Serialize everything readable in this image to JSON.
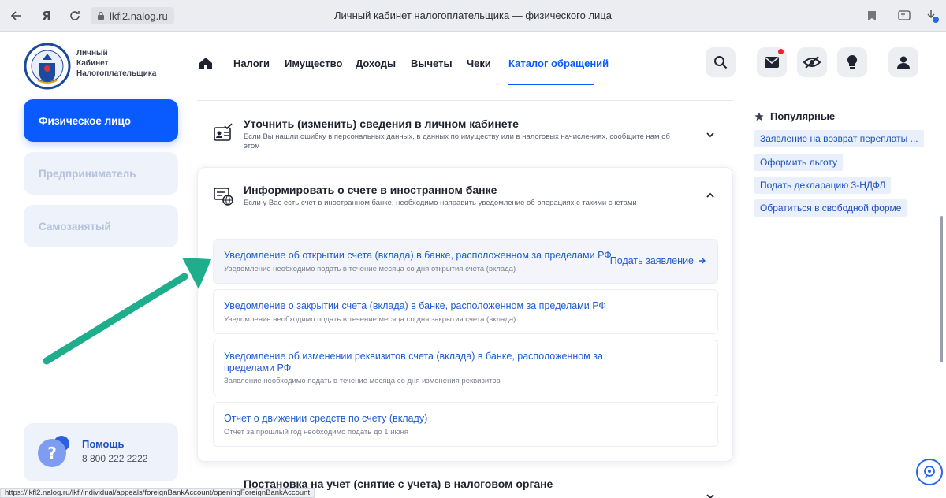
{
  "browser": {
    "url": "lkfl2.nalog.ru",
    "title": "Личный кабинет налогоплательщика — физического лица",
    "status_url": "https://lkfl2.nalog.ru/lkfl/individual/appeals/foreignBankAccount/openingForeignBankAccount"
  },
  "sidebar": {
    "logo_text": [
      "Личный",
      "Кабинет",
      "Налогоплательщика"
    ],
    "items": [
      {
        "label": "Физическое лицо",
        "active": true
      },
      {
        "label": "Предприниматель",
        "active": false
      },
      {
        "label": "Самозанятый",
        "active": false
      }
    ],
    "help": {
      "title": "Помощь",
      "phone": "8 800 222 2222"
    }
  },
  "nav": {
    "items": [
      "Налоги",
      "Имущество",
      "Доходы",
      "Вычеты",
      "Чеки",
      "Каталог обращений"
    ],
    "active_index": 5
  },
  "sections": [
    {
      "title": "Уточнить (изменить) сведения в личном кабинете",
      "desc": "Если Вы нашли ошибку в персональных данных, в данных по имуществу или в налоговых начислениях, сообщите нам об этом"
    },
    {
      "title": "Информировать о счете в иностранном банке",
      "desc": "Если у Вас есть счет в иностранном банке, необходимо направить уведомление об операциях с такими счетами"
    },
    {
      "title": "Постановка на учет (снятие с учета) в налоговом органе",
      "desc": ""
    }
  ],
  "sub_items": [
    {
      "title": "Уведомление об открытии счета (вклада) в банке, расположенном за пределами РФ",
      "desc": "Уведомление необходимо подать в течение месяца со дня открытия счета (вклада)",
      "action": "Подать заявление"
    },
    {
      "title": "Уведомление о закрытии счета (вклада) в банке, расположенном за пределами РФ",
      "desc": "Уведомление необходимо подать в течение месяца со дня закрытия счета (вклада)"
    },
    {
      "title_line1": "Уведомление об изменении реквизитов счета (вклада) в банке, расположенном за",
      "title_line2": "пределами РФ",
      "desc": "Заявление необходимо подать в течение месяца со дня изменения реквизитов"
    },
    {
      "title": "Отчет о движении средств по счету (вкладу)",
      "desc": "Отчет за прошлый год необходимо подать до 1 июня"
    }
  ],
  "popular": {
    "heading": "Популярные",
    "tags": [
      "Заявление на возврат переплаты ...",
      "Оформить льготу",
      "Подать декларацию 3-НДФЛ",
      "Обратиться в свободной форме"
    ]
  },
  "colors": {
    "accent": "#0a5bff",
    "link": "#1f5cd1",
    "annotation_arrow": "#1fae8c"
  }
}
